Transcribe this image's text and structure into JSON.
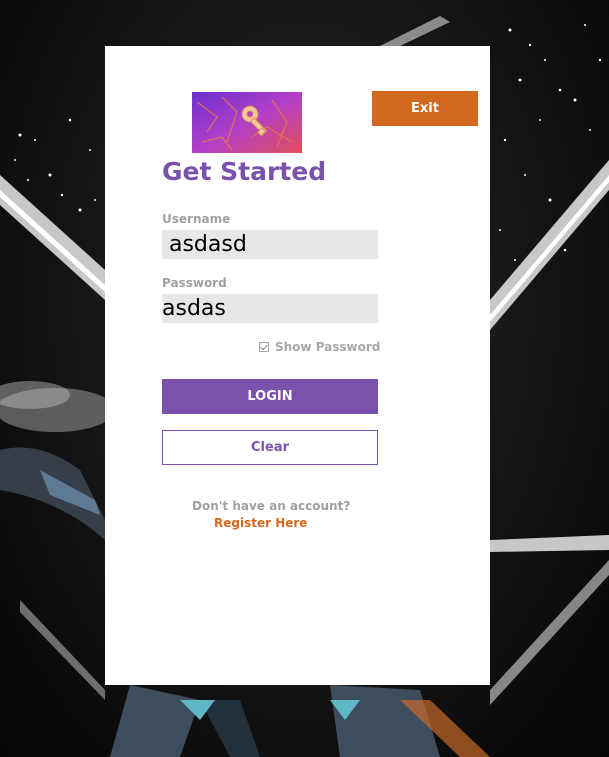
{
  "background": {
    "description_icon": "space-sparkle-background"
  },
  "header": {
    "exit_label": "Exit",
    "logo_icon": "key-logo-icon"
  },
  "title": "Get Started",
  "form": {
    "username_label": "Username",
    "username_value": " asdasd",
    "password_label": "Password",
    "password_value": "asdas",
    "show_password_label": "Show Password",
    "show_password_checked": true
  },
  "actions": {
    "login_label": "LOGIN",
    "clear_label": "Clear"
  },
  "footer": {
    "no_account_text": "Don't have an account?",
    "register_label": "Register Here"
  },
  "colors": {
    "accent_purple": "#7b52ab",
    "accent_orange": "#d2691e",
    "input_bg": "#e6e7e8",
    "label_gray": "#a0a0a0"
  }
}
